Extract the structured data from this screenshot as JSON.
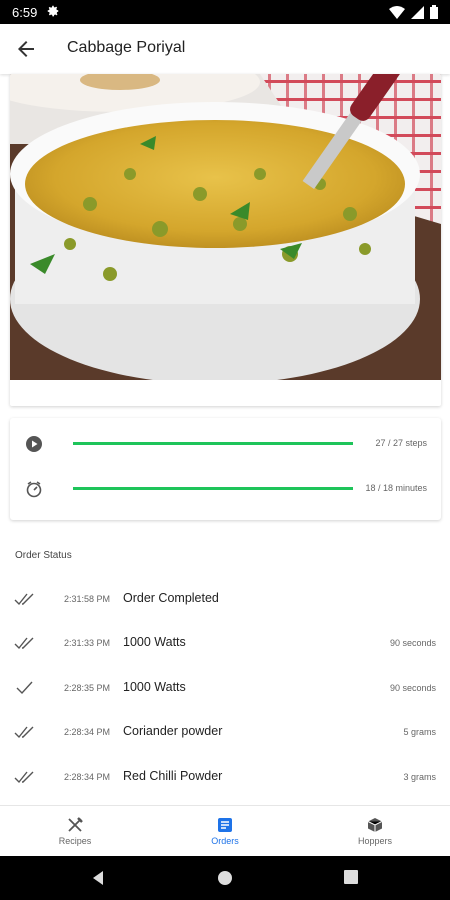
{
  "status_bar": {
    "time": "6:59"
  },
  "app_bar": {
    "title": "Cabbage Poriyal"
  },
  "progress": [
    {
      "icon": "play-circle-icon",
      "label": "27 / 27 steps",
      "fraction": 1.0
    },
    {
      "icon": "timer-icon",
      "label": "18 / 18 minutes",
      "fraction": 1.0
    }
  ],
  "order_status": {
    "heading": "Order Status",
    "items": [
      {
        "time": "2:31:58 PM",
        "name": "Order Completed",
        "qty": "",
        "check": "double"
      },
      {
        "time": "2:31:33 PM",
        "name": "1000 Watts",
        "qty": "90 seconds",
        "check": "double"
      },
      {
        "time": "2:28:35 PM",
        "name": "1000 Watts",
        "qty": "90 seconds",
        "check": "single"
      },
      {
        "time": "2:28:34 PM",
        "name": "Coriander powder",
        "qty": "5 grams",
        "check": "double"
      },
      {
        "time": "2:28:34 PM",
        "name": "Red Chilli Powder",
        "qty": "3 grams",
        "check": "double"
      }
    ]
  },
  "bottom_nav": [
    {
      "label": "Recipes",
      "icon": "fork-knife-icon",
      "active": false
    },
    {
      "label": "Orders",
      "icon": "orders-list-icon",
      "active": true
    },
    {
      "label": "Hoppers",
      "icon": "box-icon",
      "active": false
    }
  ],
  "colors": {
    "accent": "#1e73e8",
    "progress": "#1ec45a"
  }
}
